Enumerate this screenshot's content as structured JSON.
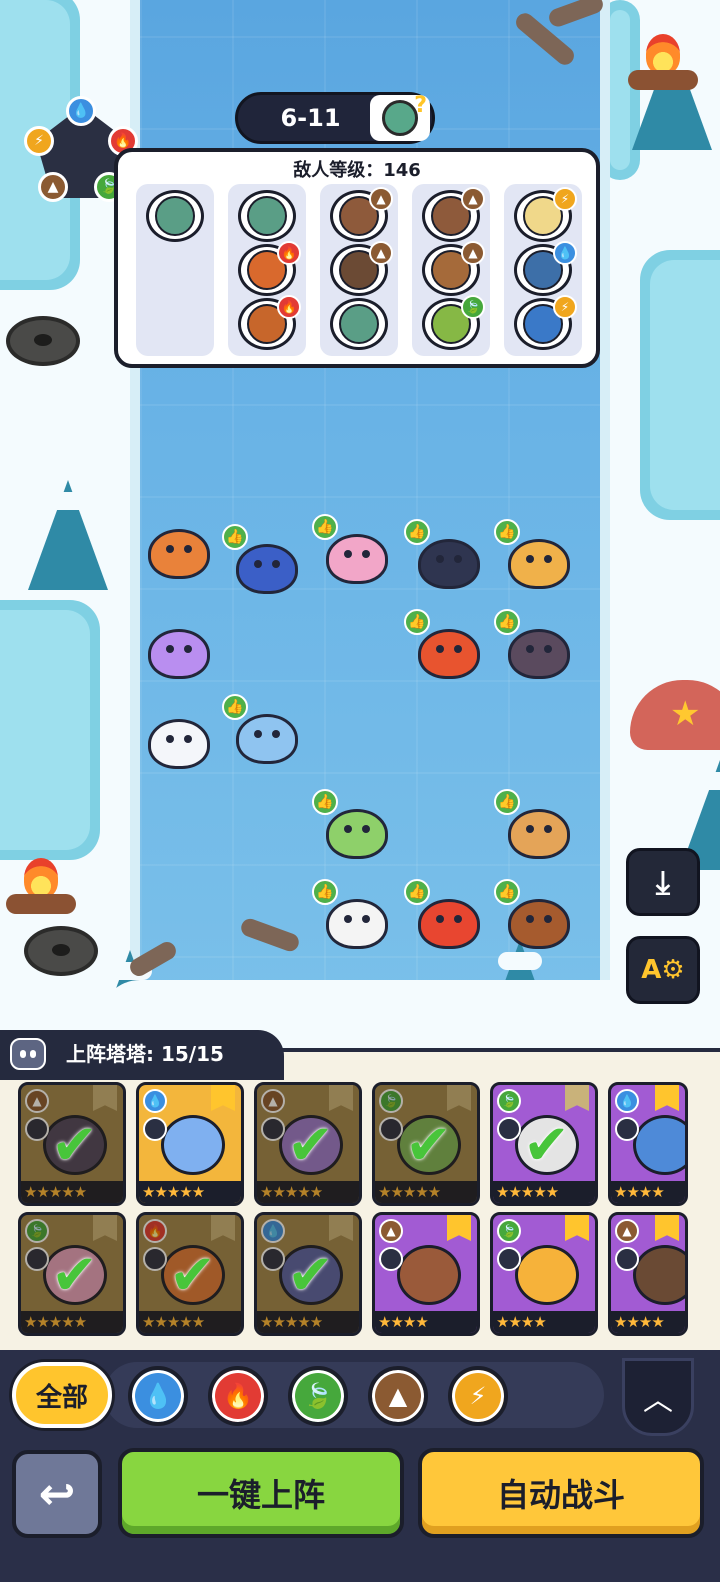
{
  "level": {
    "stage": "6-11"
  },
  "enemy_panel": {
    "level_label": "敌人等级：146",
    "waves": [
      {
        "enemies": [
          {
            "color": "#5a9e86"
          }
        ]
      },
      {
        "enemies": [
          {
            "color": "#5a9e86"
          },
          {
            "color": "#d9692d",
            "element": "fire"
          },
          {
            "color": "#c7662b",
            "element": "fire"
          }
        ]
      },
      {
        "enemies": [
          {
            "color": "#8e5a3b",
            "element": "earth"
          },
          {
            "color": "#6b4a34",
            "element": "earth"
          },
          {
            "color": "#5a9e86"
          }
        ]
      },
      {
        "enemies": [
          {
            "color": "#8e5a3b",
            "element": "earth"
          },
          {
            "color": "#a56a3a",
            "element": "earth"
          },
          {
            "color": "#86b845",
            "element": "grass"
          }
        ]
      },
      {
        "enemies": [
          {
            "color": "#f0d88a",
            "element": "thunder"
          },
          {
            "color": "#3d6fa8",
            "element": "water"
          },
          {
            "color": "#3a79c8",
            "element": "thunder"
          }
        ]
      }
    ]
  },
  "element_colors": {
    "water": "#3b8fe0",
    "fire": "#e23b34",
    "grass": "#46a83c",
    "earth": "#8b5a32",
    "thunder": "#f0a61e"
  },
  "element_glyphs": {
    "water": "💧",
    "fire": "🔥",
    "grass": "🍃",
    "earth": "▲",
    "thunder": "⚡"
  },
  "placed_pets": [
    {
      "name": "fire-rabbit",
      "color": "#e9823a",
      "thumb": false
    },
    {
      "name": "blue-bird",
      "color": "#3b5fc7",
      "thumb": true
    },
    {
      "name": "mantis",
      "color": "#f2a6c8",
      "thumb": true
    },
    {
      "name": "husky",
      "color": "#2f3550",
      "thumb": true
    },
    {
      "name": "tiger",
      "color": "#f0b14a",
      "thumb": true
    },
    {
      "name": "purple-cat",
      "color": "#b98ef0",
      "thumb": false
    },
    {
      "name": "fire-fish",
      "color": "#e8542f",
      "thumb": true
    },
    {
      "name": "dino",
      "color": "#5a4a5e",
      "thumb": true
    },
    {
      "name": "sheep",
      "color": "#f4f6fa",
      "thumb": false
    },
    {
      "name": "moth",
      "color": "#8fc4f0",
      "thumb": true
    },
    {
      "name": "plant-cat",
      "color": "#8ed06a",
      "thumb": true
    },
    {
      "name": "deer",
      "color": "#e4a458",
      "thumb": true
    },
    {
      "name": "panda",
      "color": "#f4f4f4",
      "thumb": true
    },
    {
      "name": "fire-frog",
      "color": "#e84630",
      "thumb": true
    },
    {
      "name": "monkey",
      "color": "#a65b2e",
      "thumb": true
    }
  ],
  "side_buttons": {
    "download": "⤓",
    "font": "A⚙"
  },
  "deck": {
    "label": "上阵塔塔: 15/15",
    "cards": [
      {
        "tint": "owned",
        "element": "earth",
        "portrait": "#4f4560",
        "stars": "★★★★★",
        "checked": true,
        "bookmark": "dim"
      },
      {
        "tint": "gold",
        "element": "water",
        "portrait": "#7fb0f0",
        "stars": "★★★★★",
        "checked": false,
        "bookmark": "gold"
      },
      {
        "tint": "owned",
        "element": "earth",
        "portrait": "#9b7ad0",
        "stars": "★★★★★",
        "checked": true,
        "bookmark": "dim"
      },
      {
        "tint": "owned",
        "element": "grass",
        "portrait": "#7fb55a",
        "stars": "★★★★★",
        "checked": true,
        "bookmark": "dim"
      },
      {
        "tint": "purple",
        "element": "grass",
        "portrait": "#e4e4e4",
        "stars": "★★★★★",
        "checked": true,
        "bookmark": "dim"
      },
      {
        "tint": "purple",
        "element": "water",
        "portrait": "#4e8ad8",
        "stars": "★★★★",
        "checked": false,
        "bookmark": "gold"
      },
      {
        "tint": "owned",
        "element": "grass",
        "portrait": "#e6a2c0",
        "stars": "★★★★★",
        "checked": true,
        "bookmark": "dim"
      },
      {
        "tint": "owned",
        "element": "fire",
        "portrait": "#e07a3a",
        "stars": "★★★★★",
        "checked": true,
        "bookmark": "dim"
      },
      {
        "tint": "owned",
        "element": "water",
        "portrait": "#5a63a8",
        "stars": "★★★★★",
        "checked": true,
        "bookmark": "dim"
      },
      {
        "tint": "purple",
        "element": "earth",
        "portrait": "#9a5a3a",
        "stars": "★★★★",
        "checked": false,
        "bookmark": "gold"
      },
      {
        "tint": "purple",
        "element": "grass",
        "portrait": "#f6b23a",
        "stars": "★★★★",
        "checked": false,
        "bookmark": "gold"
      },
      {
        "tint": "purple",
        "element": "earth",
        "portrait": "#6a4a34",
        "stars": "★★★★",
        "checked": false,
        "bookmark": "gold"
      }
    ]
  },
  "filters": {
    "all_label": "全部",
    "elements": [
      "water",
      "fire",
      "grass",
      "earth",
      "thunder"
    ]
  },
  "actions": {
    "back_glyph": "↩",
    "deploy_label": "一键上阵",
    "auto_label": "自动战斗",
    "collapse_glyph": "︿"
  }
}
